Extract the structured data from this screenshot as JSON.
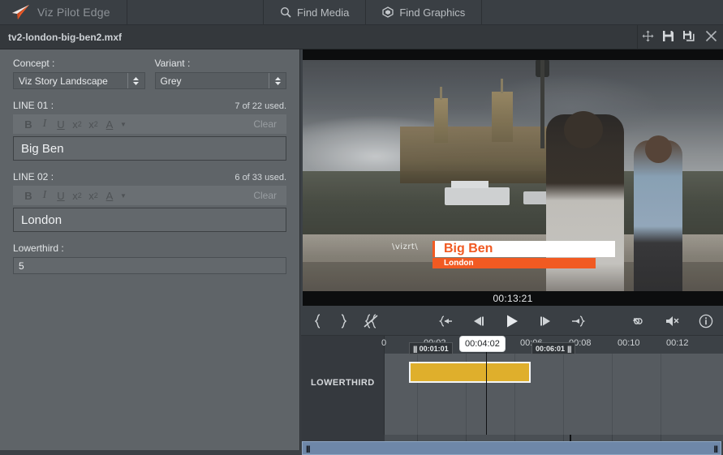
{
  "app": {
    "brand": "Viz Pilot Edge",
    "logo_icon": "viz-arrow-logo"
  },
  "topbar": {
    "find_media": "Find Media",
    "find_media_icon": "search-icon",
    "find_graphics": "Find Graphics",
    "find_graphics_icon": "cube-icon"
  },
  "docbar": {
    "filename": "tv2-london-big-ben2.mxf",
    "buttons": [
      {
        "name": "move-button",
        "icon": "move-arrows-icon"
      },
      {
        "name": "save-button",
        "icon": "floppy-save-icon"
      },
      {
        "name": "save-as-button",
        "icon": "floppy-save-as-icon"
      },
      {
        "name": "close-button",
        "icon": "close-x-icon"
      }
    ]
  },
  "form": {
    "concept": {
      "label": "Concept :",
      "value": "Viz Story Landscape"
    },
    "variant": {
      "label": "Variant :",
      "value": "Grey"
    },
    "line01": {
      "label": "LINE 01 :",
      "counter": "7 of 22 used.",
      "clear": "Clear",
      "value": "Big Ben"
    },
    "line02": {
      "label": "LINE 02 :",
      "counter": "6 of 33 used.",
      "clear": "Clear",
      "value": "London"
    },
    "lowerthird": {
      "label": "Lowerthird :",
      "value": "5"
    },
    "rte": {
      "bold": "B",
      "italic": "I",
      "underline": "U",
      "subscript_base": "x",
      "subscript_sub": "2",
      "superscript_base": "x",
      "superscript_sup": "2",
      "textcolor": "A",
      "caret": "▼"
    }
  },
  "video": {
    "timecode": "00:13:21",
    "overlay": {
      "logo_text": "\\vizrt\\",
      "title": "Big Ben",
      "subtitle": "London",
      "accent_color": "#f15a22"
    }
  },
  "player_controls": {
    "left": [
      {
        "name": "set-mark-in-button",
        "icon": "mark-in-icon"
      },
      {
        "name": "set-mark-out-button",
        "icon": "mark-out-icon"
      },
      {
        "name": "clear-marks-button",
        "icon": "clear-marks-icon"
      }
    ],
    "center": [
      {
        "name": "go-to-in-point-button",
        "icon": "jump-to-in-icon"
      },
      {
        "name": "step-back-button",
        "icon": "step-backward-icon"
      },
      {
        "name": "play-button",
        "icon": "play-icon"
      },
      {
        "name": "step-forward-button",
        "icon": "step-forward-icon"
      },
      {
        "name": "go-to-out-point-button",
        "icon": "jump-to-out-icon"
      }
    ],
    "right": [
      {
        "name": "loop-button",
        "icon": "infinity-loop-icon"
      },
      {
        "name": "mute-button",
        "icon": "speaker-muted-icon"
      },
      {
        "name": "info-button",
        "icon": "info-circle-icon"
      }
    ]
  },
  "timeline": {
    "track_name": "LOWERTHIRD",
    "ruler_ticks": [
      "0",
      "00:02",
      "00:04",
      "00:06",
      "00:08",
      "00:10",
      "00:12"
    ],
    "playhead": "00:04:02",
    "clip_in_marker": "00:01:01",
    "clip_out_marker": "00:06:01",
    "grip": "|||",
    "clip_color": "#dfaf2c"
  },
  "scrollbar": {
    "left_grip": "|||",
    "right_grip": "|||"
  }
}
